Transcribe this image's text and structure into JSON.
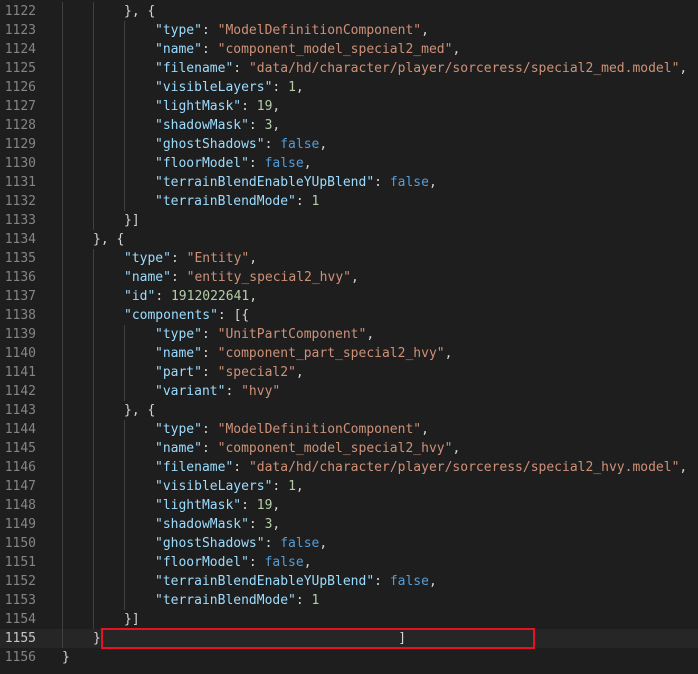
{
  "editor": {
    "current_line": 1155,
    "highlight_color": "#e81123",
    "lines": [
      {
        "num": "1122",
        "indent": 2,
        "tokens": [
          [
            "}, {",
            "pun"
          ]
        ]
      },
      {
        "num": "1123",
        "indent": 3,
        "tokens": [
          [
            "\"type\"",
            "key"
          ],
          [
            ": ",
            "pun"
          ],
          [
            "\"ModelDefinitionComponent\"",
            "str"
          ],
          [
            ",",
            "pun"
          ]
        ]
      },
      {
        "num": "1124",
        "indent": 3,
        "tokens": [
          [
            "\"name\"",
            "key"
          ],
          [
            ": ",
            "pun"
          ],
          [
            "\"component_model_special2_med\"",
            "str"
          ],
          [
            ",",
            "pun"
          ]
        ]
      },
      {
        "num": "1125",
        "indent": 3,
        "tokens": [
          [
            "\"filename\"",
            "key"
          ],
          [
            ": ",
            "pun"
          ],
          [
            "\"data/hd/character/player/sorceress/special2_med.model\"",
            "str"
          ],
          [
            ",",
            "pun"
          ]
        ]
      },
      {
        "num": "1126",
        "indent": 3,
        "tokens": [
          [
            "\"visibleLayers\"",
            "key"
          ],
          [
            ": ",
            "pun"
          ],
          [
            "1",
            "num"
          ],
          [
            ",",
            "pun"
          ]
        ]
      },
      {
        "num": "1127",
        "indent": 3,
        "tokens": [
          [
            "\"lightMask\"",
            "key"
          ],
          [
            ": ",
            "pun"
          ],
          [
            "19",
            "num"
          ],
          [
            ",",
            "pun"
          ]
        ]
      },
      {
        "num": "1128",
        "indent": 3,
        "tokens": [
          [
            "\"shadowMask\"",
            "key"
          ],
          [
            ": ",
            "pun"
          ],
          [
            "3",
            "num"
          ],
          [
            ",",
            "pun"
          ]
        ]
      },
      {
        "num": "1129",
        "indent": 3,
        "tokens": [
          [
            "\"ghostShadows\"",
            "key"
          ],
          [
            ": ",
            "pun"
          ],
          [
            "false",
            "kw"
          ],
          [
            ",",
            "pun"
          ]
        ]
      },
      {
        "num": "1130",
        "indent": 3,
        "tokens": [
          [
            "\"floorModel\"",
            "key"
          ],
          [
            ": ",
            "pun"
          ],
          [
            "false",
            "kw"
          ],
          [
            ",",
            "pun"
          ]
        ]
      },
      {
        "num": "1131",
        "indent": 3,
        "tokens": [
          [
            "\"terrainBlendEnableYUpBlend\"",
            "key"
          ],
          [
            ": ",
            "pun"
          ],
          [
            "false",
            "kw"
          ],
          [
            ",",
            "pun"
          ]
        ]
      },
      {
        "num": "1132",
        "indent": 3,
        "tokens": [
          [
            "\"terrainBlendMode\"",
            "key"
          ],
          [
            ": ",
            "pun"
          ],
          [
            "1",
            "num"
          ]
        ]
      },
      {
        "num": "1133",
        "indent": 2,
        "tokens": [
          [
            "}]",
            "pun"
          ]
        ]
      },
      {
        "num": "1134",
        "indent": 1,
        "tokens": [
          [
            "}, {",
            "pun"
          ]
        ]
      },
      {
        "num": "1135",
        "indent": 2,
        "tokens": [
          [
            "\"type\"",
            "key"
          ],
          [
            ": ",
            "pun"
          ],
          [
            "\"Entity\"",
            "str"
          ],
          [
            ",",
            "pun"
          ]
        ]
      },
      {
        "num": "1136",
        "indent": 2,
        "tokens": [
          [
            "\"name\"",
            "key"
          ],
          [
            ": ",
            "pun"
          ],
          [
            "\"entity_special2_hvy\"",
            "str"
          ],
          [
            ",",
            "pun"
          ]
        ]
      },
      {
        "num": "1137",
        "indent": 2,
        "tokens": [
          [
            "\"id\"",
            "key"
          ],
          [
            ": ",
            "pun"
          ],
          [
            "1912022641",
            "num"
          ],
          [
            ",",
            "pun"
          ]
        ]
      },
      {
        "num": "1138",
        "indent": 2,
        "tokens": [
          [
            "\"components\"",
            "key"
          ],
          [
            ": [{",
            "pun"
          ]
        ]
      },
      {
        "num": "1139",
        "indent": 3,
        "tokens": [
          [
            "\"type\"",
            "key"
          ],
          [
            ": ",
            "pun"
          ],
          [
            "\"UnitPartComponent\"",
            "str"
          ],
          [
            ",",
            "pun"
          ]
        ]
      },
      {
        "num": "1140",
        "indent": 3,
        "tokens": [
          [
            "\"name\"",
            "key"
          ],
          [
            ": ",
            "pun"
          ],
          [
            "\"component_part_special2_hvy\"",
            "str"
          ],
          [
            ",",
            "pun"
          ]
        ]
      },
      {
        "num": "1141",
        "indent": 3,
        "tokens": [
          [
            "\"part\"",
            "key"
          ],
          [
            ": ",
            "pun"
          ],
          [
            "\"special2\"",
            "str"
          ],
          [
            ",",
            "pun"
          ]
        ]
      },
      {
        "num": "1142",
        "indent": 3,
        "tokens": [
          [
            "\"variant\"",
            "key"
          ],
          [
            ": ",
            "pun"
          ],
          [
            "\"hvy\"",
            "str"
          ]
        ]
      },
      {
        "num": "1143",
        "indent": 2,
        "tokens": [
          [
            "}, {",
            "pun"
          ]
        ]
      },
      {
        "num": "1144",
        "indent": 3,
        "tokens": [
          [
            "\"type\"",
            "key"
          ],
          [
            ": ",
            "pun"
          ],
          [
            "\"ModelDefinitionComponent\"",
            "str"
          ],
          [
            ",",
            "pun"
          ]
        ]
      },
      {
        "num": "1145",
        "indent": 3,
        "tokens": [
          [
            "\"name\"",
            "key"
          ],
          [
            ": ",
            "pun"
          ],
          [
            "\"component_model_special2_hvy\"",
            "str"
          ],
          [
            ",",
            "pun"
          ]
        ]
      },
      {
        "num": "1146",
        "indent": 3,
        "tokens": [
          [
            "\"filename\"",
            "key"
          ],
          [
            ": ",
            "pun"
          ],
          [
            "\"data/hd/character/player/sorceress/special2_hvy.model\"",
            "str"
          ],
          [
            ",",
            "pun"
          ]
        ]
      },
      {
        "num": "1147",
        "indent": 3,
        "tokens": [
          [
            "\"visibleLayers\"",
            "key"
          ],
          [
            ": ",
            "pun"
          ],
          [
            "1",
            "num"
          ],
          [
            ",",
            "pun"
          ]
        ]
      },
      {
        "num": "1148",
        "indent": 3,
        "tokens": [
          [
            "\"lightMask\"",
            "key"
          ],
          [
            ": ",
            "pun"
          ],
          [
            "19",
            "num"
          ],
          [
            ",",
            "pun"
          ]
        ]
      },
      {
        "num": "1149",
        "indent": 3,
        "tokens": [
          [
            "\"shadowMask\"",
            "key"
          ],
          [
            ": ",
            "pun"
          ],
          [
            "3",
            "num"
          ],
          [
            ",",
            "pun"
          ]
        ]
      },
      {
        "num": "1150",
        "indent": 3,
        "tokens": [
          [
            "\"ghostShadows\"",
            "key"
          ],
          [
            ": ",
            "pun"
          ],
          [
            "false",
            "kw"
          ],
          [
            ",",
            "pun"
          ]
        ]
      },
      {
        "num": "1151",
        "indent": 3,
        "tokens": [
          [
            "\"floorModel\"",
            "key"
          ],
          [
            ": ",
            "pun"
          ],
          [
            "false",
            "kw"
          ],
          [
            ",",
            "pun"
          ]
        ]
      },
      {
        "num": "1152",
        "indent": 3,
        "tokens": [
          [
            "\"terrainBlendEnableYUpBlend\"",
            "key"
          ],
          [
            ": ",
            "pun"
          ],
          [
            "false",
            "kw"
          ],
          [
            ",",
            "pun"
          ]
        ]
      },
      {
        "num": "1153",
        "indent": 3,
        "tokens": [
          [
            "\"terrainBlendMode\"",
            "key"
          ],
          [
            ": ",
            "pun"
          ],
          [
            "1",
            "num"
          ]
        ]
      },
      {
        "num": "1154",
        "indent": 2,
        "tokens": [
          [
            "}]",
            "pun"
          ]
        ]
      },
      {
        "num": "1155",
        "indent": 1,
        "tokens": [
          [
            "}",
            "pun"
          ],
          [
            "                                      ",
            "pun"
          ],
          [
            "]",
            "pun"
          ]
        ]
      },
      {
        "num": "1156",
        "indent": 0,
        "tokens": [
          [
            "}",
            "pun"
          ]
        ]
      }
    ]
  }
}
